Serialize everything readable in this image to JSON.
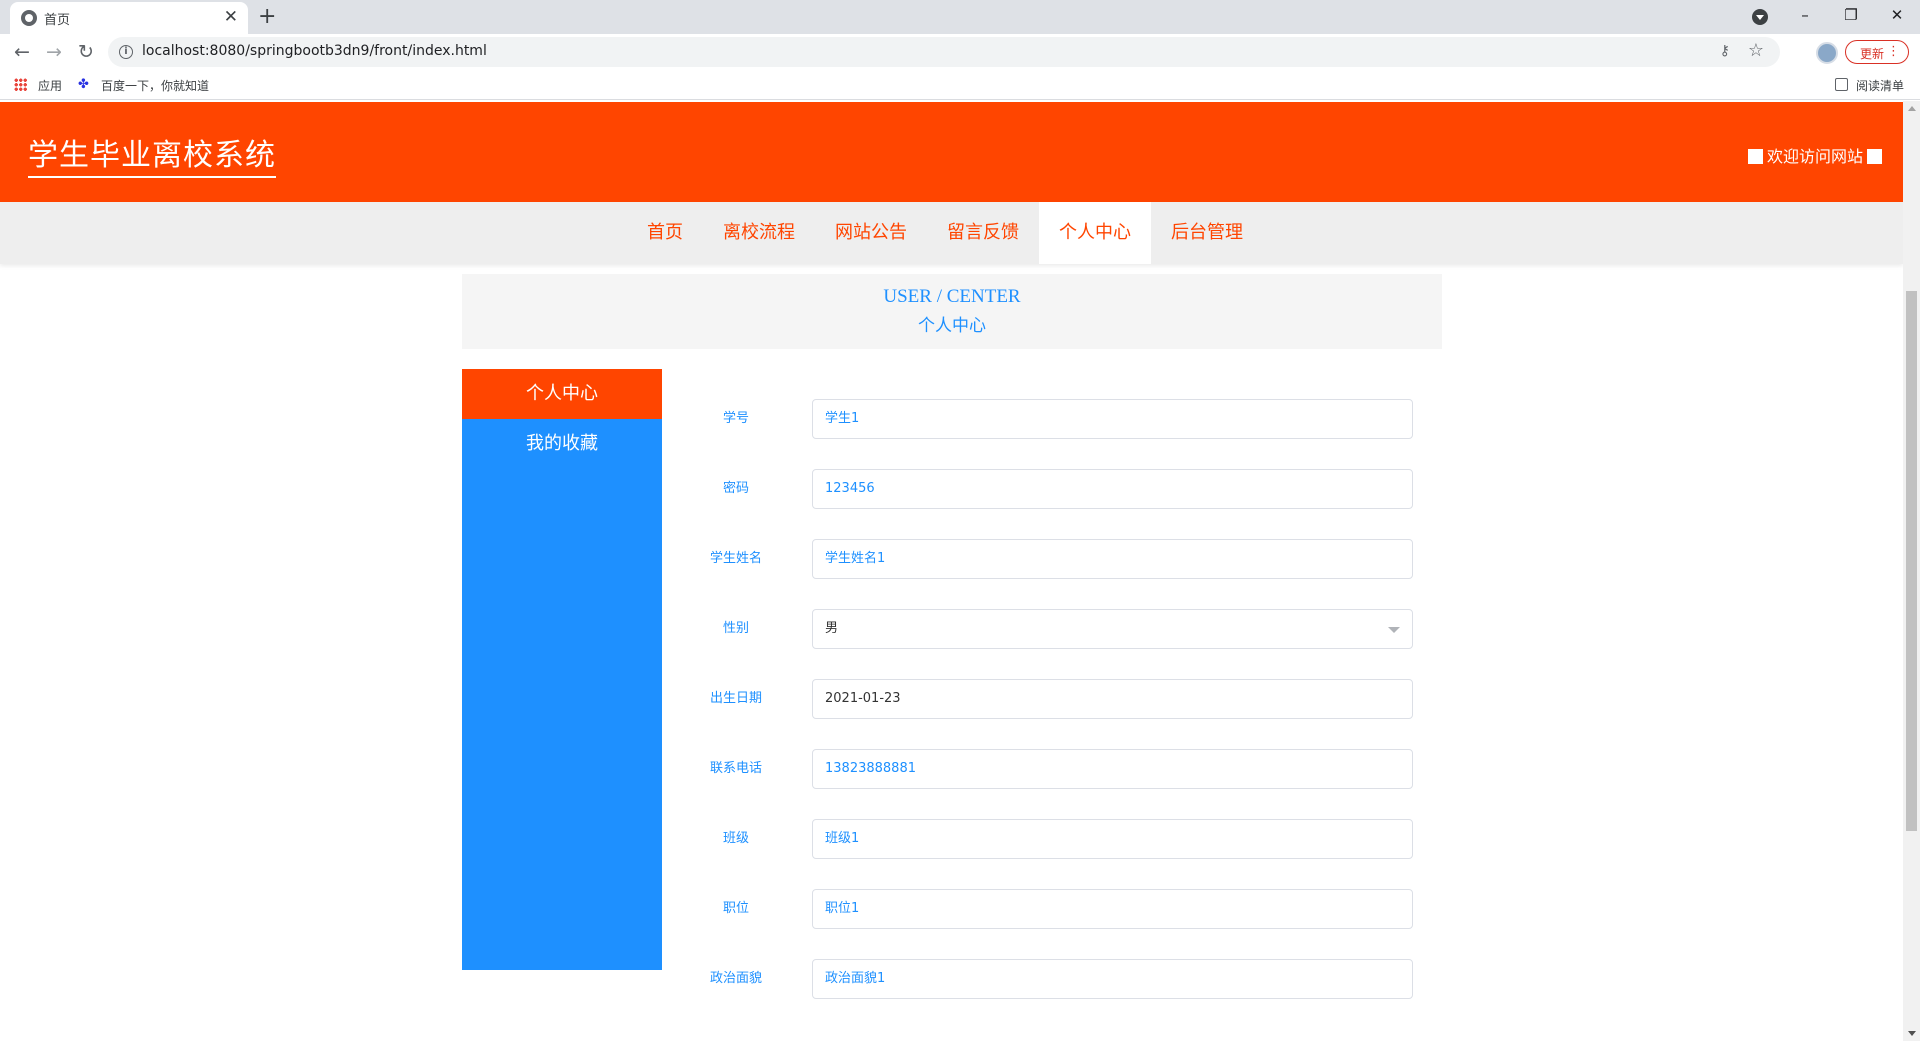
{
  "browser": {
    "tab_title": "首页",
    "tab_close": "✕",
    "new_tab": "+",
    "url": "localhost:8080/springbootb3dn9/front/index.html",
    "update_label": "更新",
    "bookmarks": [
      "应用",
      "百度一下，你就知道"
    ],
    "reading_list": "阅读清单",
    "nav": {
      "back": "←",
      "forward": "→",
      "reload": "↻"
    },
    "window_controls": {
      "minimize": "–",
      "restore": "❐",
      "close": "✕"
    }
  },
  "site": {
    "title": "学生毕业离校系统",
    "welcome": "欢迎访问网站",
    "brand_color": "#ff4500",
    "accent_color": "#1e90ff"
  },
  "nav": {
    "items": [
      {
        "label": "首页",
        "active": false
      },
      {
        "label": "离校流程",
        "active": false
      },
      {
        "label": "网站公告",
        "active": false
      },
      {
        "label": "留言反馈",
        "active": false
      },
      {
        "label": "个人中心",
        "active": true
      },
      {
        "label": "后台管理",
        "active": false
      }
    ]
  },
  "banner": {
    "en": "USER / CENTER",
    "zh": "个人中心"
  },
  "side_menu": [
    {
      "label": "个人中心",
      "active": true
    },
    {
      "label": "我的收藏",
      "active": false
    }
  ],
  "form": {
    "fields": [
      {
        "label": "学号",
        "value": "学生1"
      },
      {
        "label": "密码",
        "value": "123456"
      },
      {
        "label": "学生姓名",
        "value": "学生姓名1"
      },
      {
        "label": "性别",
        "value": "男",
        "type": "select"
      },
      {
        "label": "出生日期",
        "value": "2021-01-23"
      },
      {
        "label": "联系电话",
        "value": "13823888881"
      },
      {
        "label": "班级",
        "value": "班级1"
      },
      {
        "label": "职位",
        "value": "职位1"
      },
      {
        "label": "政治面貌",
        "value": "政治面貌1"
      }
    ]
  }
}
